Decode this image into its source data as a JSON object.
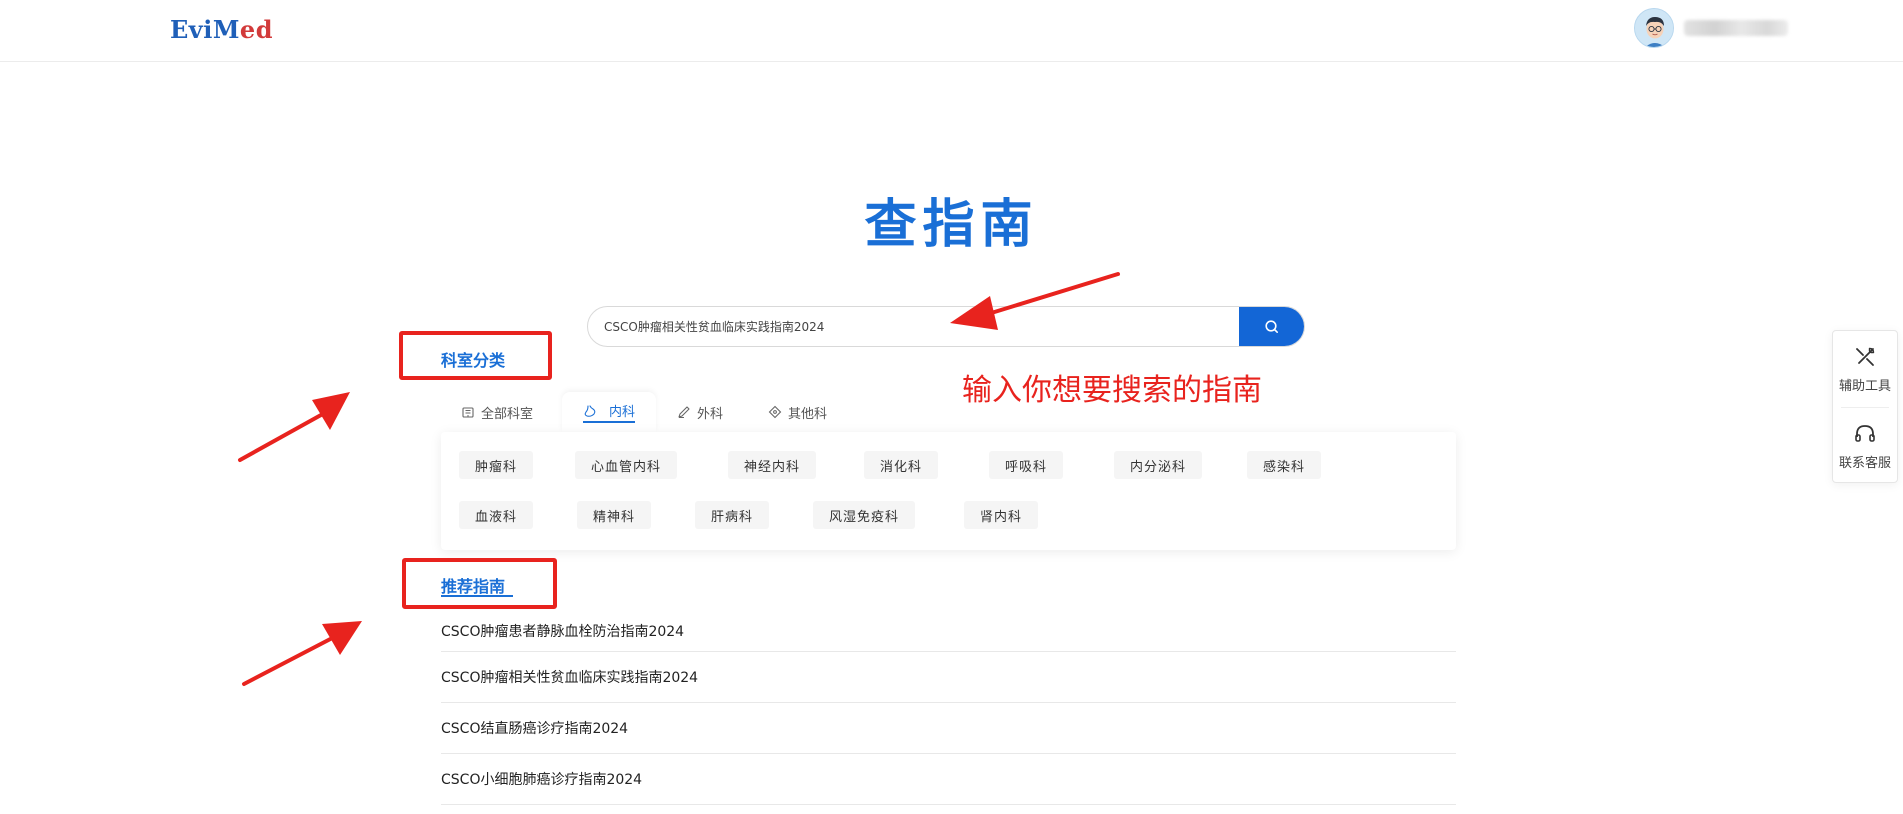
{
  "header": {
    "logo_part1": "EviMed",
    "logo_part2": ""
  },
  "page": {
    "title": "查指南"
  },
  "search": {
    "value": "CSCO肿瘤相关性贫血临床实践指南2024",
    "placeholder": ""
  },
  "annotation": {
    "hint": "输入你想要搜索的指南"
  },
  "departments": {
    "section_label": "科室分类",
    "tabs": [
      {
        "label": "全部科室",
        "icon": "building-icon"
      },
      {
        "label": "内科",
        "icon": "stomach-icon"
      },
      {
        "label": "外科",
        "icon": "scalpel-icon"
      },
      {
        "label": "其他科",
        "icon": "diamond-icon"
      }
    ],
    "active_tab": "内科",
    "chips_row1": [
      "肿瘤科",
      "心血管内科",
      "神经内科",
      "消化科",
      "呼吸科",
      "内分泌科",
      "感染科"
    ],
    "chips_row2": [
      "血液科",
      "精神科",
      "肝病科",
      "风湿免疫科",
      "肾内科"
    ]
  },
  "recommended": {
    "section_label": "推荐指南",
    "items": [
      "CSCO肿瘤患者静脉血栓防治指南2024",
      "CSCO肿瘤相关性贫血临床实践指南2024",
      "CSCO结直肠癌诊疗指南2024",
      "CSCO小细胞肺癌诊疗指南2024"
    ]
  },
  "float_panel": {
    "tools_label": "辅助工具",
    "service_label": "联系客服"
  },
  "colors": {
    "brand_blue": "#1a6fd6",
    "button_blue": "#1366d6",
    "logo_blue": "#1f5fb8",
    "logo_red": "#d23a3a",
    "annotation_red": "#e8231e"
  }
}
